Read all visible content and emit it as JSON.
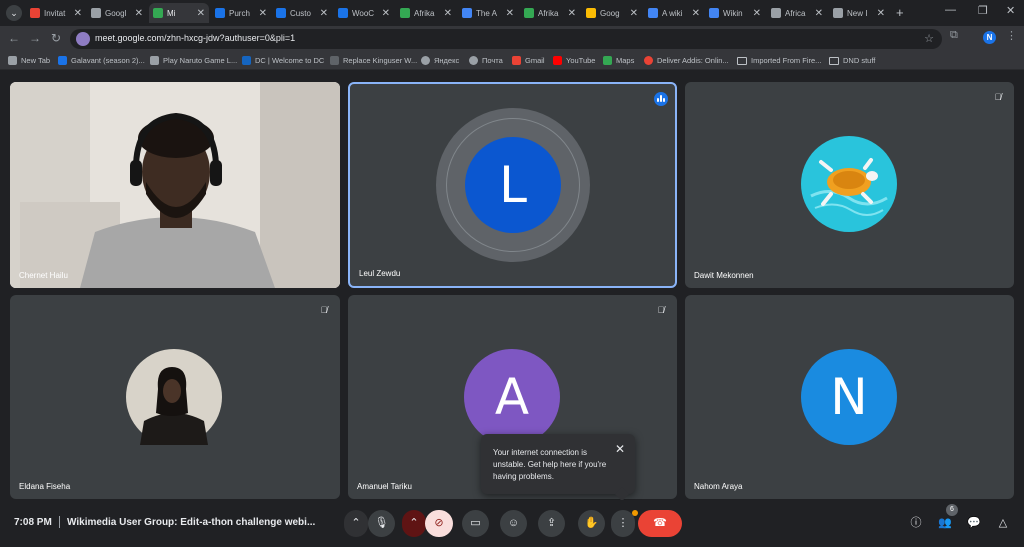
{
  "tabs": [
    {
      "label": "Invitat",
      "color": "#ea4335"
    },
    {
      "label": "Googl",
      "color": "#9aa0a6"
    },
    {
      "label": "Mi",
      "color": "#34a853"
    },
    {
      "label": "Purch",
      "color": "#1a73e8"
    },
    {
      "label": "Custo",
      "color": "#1a73e8"
    },
    {
      "label": "WooC",
      "color": "#1a73e8"
    },
    {
      "label": "Afrika",
      "color": "#34a853"
    },
    {
      "label": "The A",
      "color": "#4285f4"
    },
    {
      "label": "Afrika",
      "color": "#34a853"
    },
    {
      "label": "Goog",
      "color": "#fbbc04"
    },
    {
      "label": "A wiki",
      "color": "#4285f4"
    },
    {
      "label": "Wikin",
      "color": "#4285f4"
    },
    {
      "label": "Africa",
      "color": "#9aa0a6"
    },
    {
      "label": "New I",
      "color": "#9aa0a6"
    }
  ],
  "address_bar": {
    "url": "meet.google.com/zhn-hxcg-jdw?authuser=0&pli=1"
  },
  "bookmarks": [
    "New Tab",
    "Galavant (season 2)...",
    "Play Naruto Game L...",
    "DC | Welcome to DC",
    "Replace Kinguser W...",
    "Яндекс",
    "Почта",
    "Gmail",
    "YouTube",
    "Maps",
    "Deliver Addis: Onlin...",
    "Imported From Fire...",
    "DND stuff"
  ],
  "participants": [
    {
      "name": "Chernet Hailu"
    },
    {
      "name": "Leul Zewdu",
      "initial": "L",
      "color": "#0b57d0"
    },
    {
      "name": "Dawit Mekonnen"
    },
    {
      "name": "Eldana Fiseha"
    },
    {
      "name": "Amanuel Tariku",
      "initial": "A",
      "color": "#7e57c2"
    },
    {
      "name": "Nahom Araya",
      "initial": "N",
      "color": "#1a8be0"
    }
  ],
  "toast": {
    "message": "Your internet connection is unstable. Get help here if you're having problems."
  },
  "bottom_bar": {
    "time": "7:08 PM",
    "meeting_title": "Wikimedia User Group: Edit-a-thon challenge webi...",
    "people_count": "6"
  },
  "colors": {
    "active_speaker": "#8ab4f8",
    "end_call": "#ea4335"
  }
}
